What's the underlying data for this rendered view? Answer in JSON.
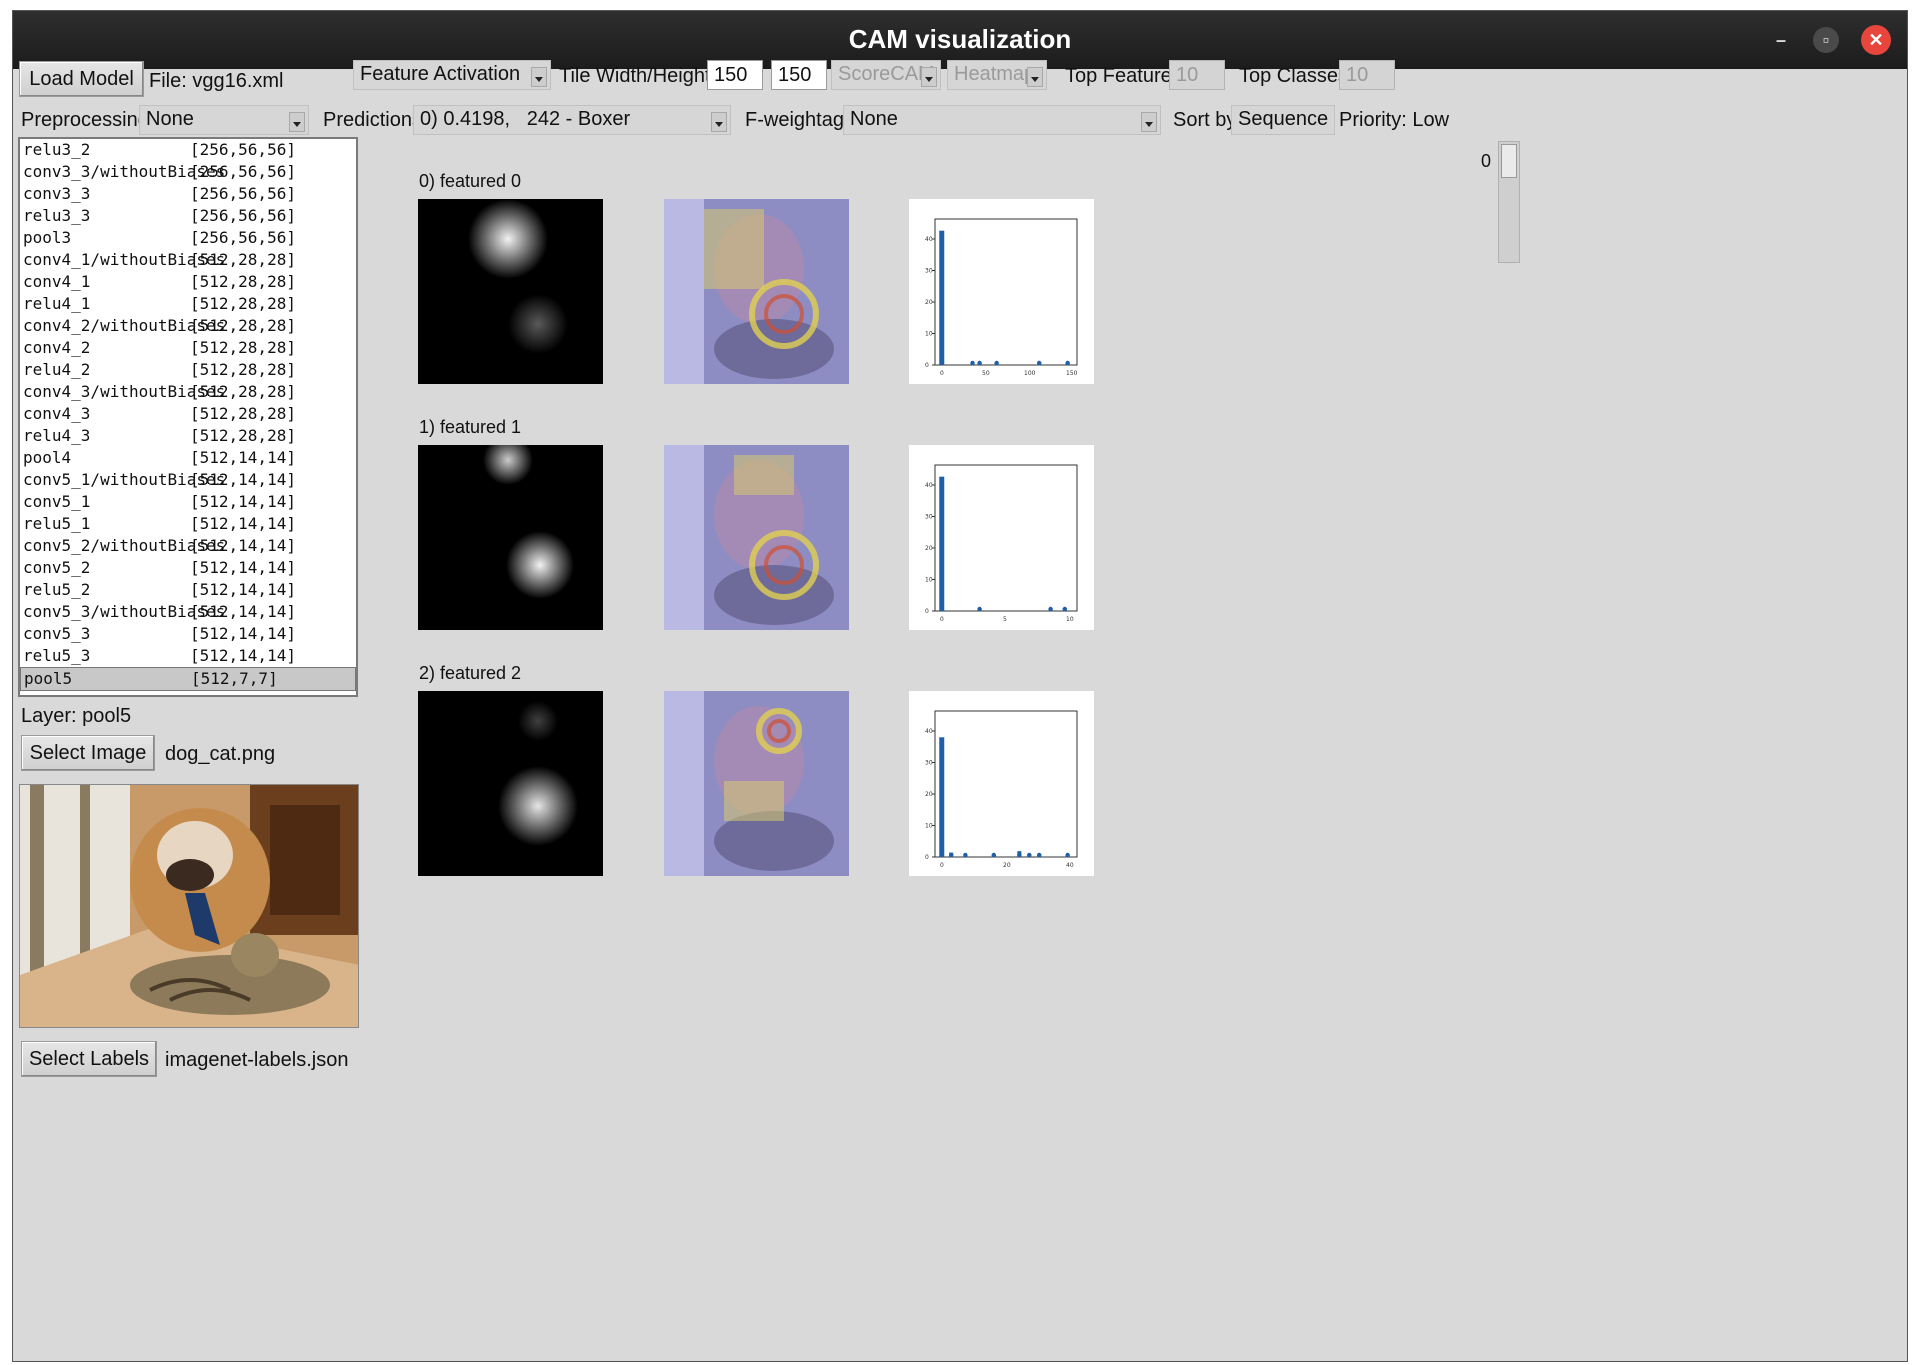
{
  "window": {
    "title": "CAM visualization"
  },
  "toolbar": {
    "load_model": "Load Model",
    "file_label": "File: vgg16.xml",
    "mode": "Feature Activation",
    "tile_label": "Tile Width/Height",
    "tile_w": "150",
    "tile_h": "150",
    "method": "ScoreCAM",
    "view": "Heatmap",
    "top_features_label": "Top Features",
    "top_features": "10",
    "top_classes_label": "Top Classes",
    "top_classes": "10"
  },
  "row2": {
    "preprocessing_label": "Preprocessing:",
    "preprocessing": "None",
    "predictions_label": "Predictions:",
    "predictions": "0) 0.4198,   242 - Boxer",
    "fweight_label": "F-weightage:",
    "fweight": "None",
    "sortby_label": "Sort by:",
    "sortby": "Sequence",
    "priority": "Priority: Low"
  },
  "layers": [
    {
      "name": "relu3_2",
      "shape": "[256,56,56]"
    },
    {
      "name": "conv3_3/withoutBiases",
      "shape": "[256,56,56]"
    },
    {
      "name": "conv3_3",
      "shape": "[256,56,56]"
    },
    {
      "name": "relu3_3",
      "shape": "[256,56,56]"
    },
    {
      "name": "pool3",
      "shape": "[256,56,56]"
    },
    {
      "name": "conv4_1/withoutBiases",
      "shape": "[512,28,28]"
    },
    {
      "name": "conv4_1",
      "shape": "[512,28,28]"
    },
    {
      "name": "relu4_1",
      "shape": "[512,28,28]"
    },
    {
      "name": "conv4_2/withoutBiases",
      "shape": "[512,28,28]"
    },
    {
      "name": "conv4_2",
      "shape": "[512,28,28]"
    },
    {
      "name": "relu4_2",
      "shape": "[512,28,28]"
    },
    {
      "name": "conv4_3/withoutBiases",
      "shape": "[512,28,28]"
    },
    {
      "name": "conv4_3",
      "shape": "[512,28,28]"
    },
    {
      "name": "relu4_3",
      "shape": "[512,28,28]"
    },
    {
      "name": "pool4",
      "shape": "[512,14,14]"
    },
    {
      "name": "conv5_1/withoutBiases",
      "shape": "[512,14,14]"
    },
    {
      "name": "conv5_1",
      "shape": "[512,14,14]"
    },
    {
      "name": "relu5_1",
      "shape": "[512,14,14]"
    },
    {
      "name": "conv5_2/withoutBiases",
      "shape": "[512,14,14]"
    },
    {
      "name": "conv5_2",
      "shape": "[512,14,14]"
    },
    {
      "name": "relu5_2",
      "shape": "[512,14,14]"
    },
    {
      "name": "conv5_3/withoutBiases",
      "shape": "[512,14,14]"
    },
    {
      "name": "conv5_3",
      "shape": "[512,14,14]"
    },
    {
      "name": "relu5_3",
      "shape": "[512,14,14]"
    },
    {
      "name": "pool5",
      "shape": "[512,7,7]"
    }
  ],
  "selected_layer_index": 24,
  "left": {
    "layer_label": "Layer: pool5",
    "select_image": "Select Image",
    "image_file": "dog_cat.png",
    "select_labels": "Select Labels",
    "labels_file": "imagenet-labels.json"
  },
  "features": [
    {
      "label": "0) featured 0",
      "hist_yticks": [
        "40",
        "30",
        "20",
        "10",
        "0"
      ],
      "hist_xticks": [
        "0",
        "50",
        "100",
        "150"
      ]
    },
    {
      "label": "1) featured 1",
      "hist_yticks": [
        "40",
        "30",
        "20",
        "10",
        "0"
      ],
      "hist_xticks": [
        "0",
        "5",
        "10"
      ]
    },
    {
      "label": "2) featured 2",
      "hist_yticks": [
        "40",
        "30",
        "20",
        "10",
        "0"
      ],
      "hist_xticks": [
        "0",
        "20",
        "40"
      ]
    }
  ],
  "scroll_value": "0",
  "colors": {
    "titlebar": "#1c1c1c",
    "window_bg": "#d9d9d9",
    "close": "#e8453c",
    "hist_bar": "#1f5fa8"
  }
}
